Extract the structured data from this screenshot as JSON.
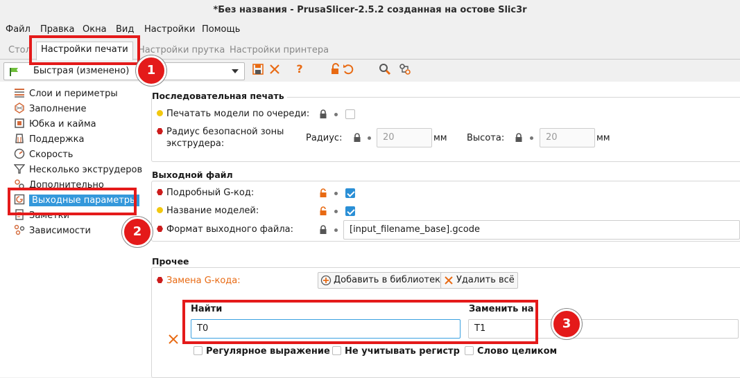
{
  "window": {
    "title": "*Без названия - PrusaSlicer-2.5.2 созданная на остове Slic3r"
  },
  "menu": [
    "Файл",
    "Правка",
    "Окна",
    "Вид",
    "Настройки",
    "Помощь"
  ],
  "tabs": {
    "plater": "Стол",
    "print": "Настройки печати",
    "filament": "Настройки прутка",
    "printer": "Настройки принтера"
  },
  "preset": {
    "value": "Быстрая (изменено)"
  },
  "sidebar": {
    "items": [
      {
        "label": "Слои и периметры"
      },
      {
        "label": "Заполнение"
      },
      {
        "label": "Юбка и кайма"
      },
      {
        "label": "Поддержка"
      },
      {
        "label": "Скорость"
      },
      {
        "label": "Несколько экструдеров"
      },
      {
        "label": "Дополнительно"
      },
      {
        "label": "Выходные параметры"
      },
      {
        "label": "Заметки"
      },
      {
        "label": "Зависимости"
      }
    ]
  },
  "sequential": {
    "title": "Последовательная печать",
    "complete_objects": "Печатать модели по очереди:",
    "clearance_label_1": "Радиус безопасной зоны",
    "clearance_label_2": "экструдера:",
    "radius_label": "Радиус:",
    "radius_value": "20",
    "height_label": "Высота:",
    "height_value": "20",
    "unit": "мм"
  },
  "output": {
    "title": "Выходной файл",
    "verbose": "Подробный G-код:",
    "label_objects": "Название моделей:",
    "format_label": "Формат выходного файла:",
    "format_value": "[input_filename_base].gcode"
  },
  "other": {
    "title": "Прочее",
    "gcode_subst": "Замена G-кода:",
    "add_button": "Добавить в библиотеку",
    "delete_all": "Удалить всё",
    "find_label": "Найти",
    "find_value": "T0",
    "replace_label": "Заменить на",
    "replace_value": "T1",
    "regex": "Регулярное выражение",
    "case": "Не учитывать регистр",
    "whole": "Слово целиком"
  },
  "annotations": [
    "1",
    "2",
    "3"
  ],
  "colors": {
    "accent": "#3498db",
    "highlight": "#e41a1a",
    "warning_orange": "#e86a13"
  }
}
